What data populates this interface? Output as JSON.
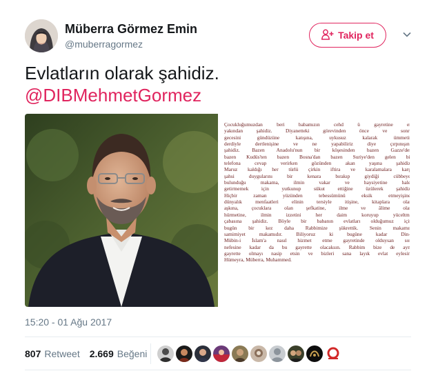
{
  "user": {
    "display_name": "Müberra Görmez Emin",
    "handle": "@muberragormez"
  },
  "follow_button": {
    "label": "Takip et"
  },
  "tweet": {
    "text_line1": "Evlatların olarak şahidiz.",
    "mention": "@DIBMehmetGormez",
    "timestamp": "15:20 - 01 Ağu 2017"
  },
  "letter_lines": [
    "Çocukluğumuzdan beri babamızın cehd ü gayretine en",
    "yakından şahidiz. Diyanetteki görevinden önce ve sonra",
    "gecesini gündüzüne katışına, uykusuz kalarak ümmetin",
    "derdiyle dertlenişine ve ne yapabiliriz diye çırpınışına",
    "şahidiz. Bazen Anadolu'nun bir köşesinden bazen Gazze'den",
    "bazen Kudüs'ten bazen Bosna'dan bazen Suriye'den gelen bir",
    "telefona cevap verirken gözünden akan yaşına şahidiz.",
    "Maruz kaldığı her türlü çirkin iftira ve karalamalara karşı",
    "şahsi duygularını bir kenara bırakıp giydiği cübbeye,",
    "bulunduğu makama, ilmin vakar ve haysiyetine halel",
    "getirmemek için yutkunup sükut ettiğine üzülerek şahidiz.",
    "Hiçbir zaman yüzünden tebessümünü eksik etmeyişine,",
    "dünyalık menfaatleri elinin tersiyle itişine, kitaplara olan",
    "aşkına, çocuklara olan şefkatine, ilme ve âlime olan",
    "hürmetine, ilmin izzetini her daim koruyup yüceltme",
    "çabasına şahidiz. Böyle bir babanın evlatları olduğumuz için",
    "bugün bir kez daha Rabbimize şükrettik. Senin makamın",
    "samimiyet makamıdır. Biliyoruz ki bugüne kadar Din-i",
    "Mübin-i İslam'a nasıl hizmet etme gayretinde olduysan son",
    "nefesine kadar da bu gayrette olacaksın. Rabbim bize de aynı",
    "gayrette olmayı nasip etsin ve bizleri sana layık evlat eylesin.",
    "Hümeyra, Müberra, Muhammed."
  ],
  "stats": {
    "retweets_count": "807",
    "retweets_label": "Retweet",
    "likes_count": "2.669",
    "likes_label": "Beğeni"
  },
  "icons": {
    "follow": "add-person-icon",
    "menu": "chevron-down-icon"
  },
  "colors": {
    "accent": "#e0245e",
    "secondary_text": "#657786",
    "letter_text": "#6b1c1c",
    "divider": "#e6ecf0"
  }
}
